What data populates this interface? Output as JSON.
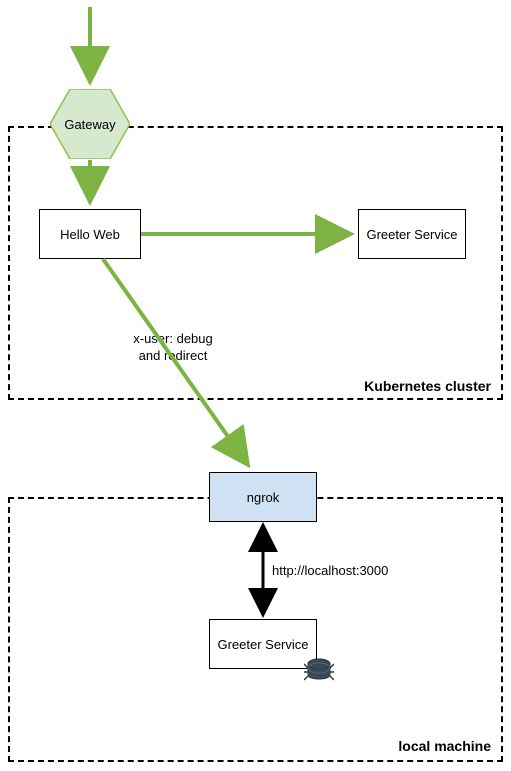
{
  "nodes": {
    "gateway": "Gateway",
    "helloWeb": "Hello Web",
    "greeterServiceTop": "Greeter Service",
    "ngrok": "ngrok",
    "greeterServiceBottom": "Greeter Service"
  },
  "edges": {
    "debugRedirect_line1": "x-user: debug",
    "debugRedirect_line2": "and redirect",
    "localhost": "http://localhost:3000"
  },
  "regions": {
    "kubernetes": "Kubernetes cluster",
    "local": "local machine"
  },
  "meta": {
    "colors": {
      "green_fill": "#d6e8ce",
      "green_stroke": "#8bc34a",
      "arrow_green": "#7cb342",
      "blue_fill": "#cfe2f3"
    }
  }
}
